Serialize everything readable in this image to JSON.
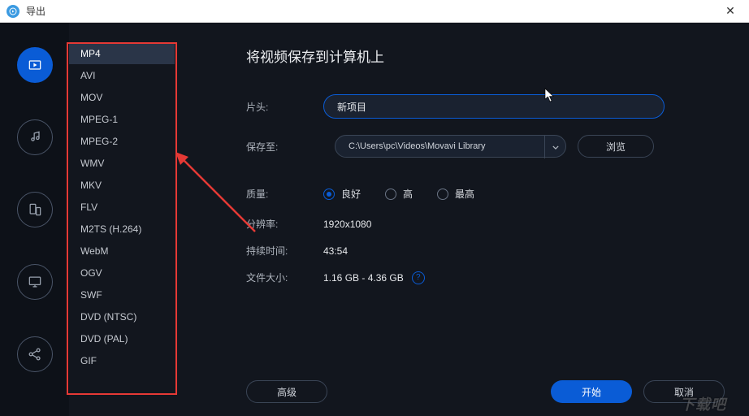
{
  "title": "导出",
  "sidebar": {
    "items": [
      {
        "name": "video-icon"
      },
      {
        "name": "music-icon"
      },
      {
        "name": "devices-icon"
      },
      {
        "name": "tv-icon"
      },
      {
        "name": "share-icon"
      }
    ]
  },
  "formats": {
    "items": [
      {
        "label": "MP4",
        "selected": true
      },
      {
        "label": "AVI"
      },
      {
        "label": "MOV"
      },
      {
        "label": "MPEG-1"
      },
      {
        "label": "MPEG-2"
      },
      {
        "label": "WMV"
      },
      {
        "label": "MKV"
      },
      {
        "label": "FLV"
      },
      {
        "label": "M2TS (H.264)"
      },
      {
        "label": "WebM"
      },
      {
        "label": "OGV"
      },
      {
        "label": "SWF"
      },
      {
        "label": "DVD (NTSC)"
      },
      {
        "label": "DVD (PAL)"
      },
      {
        "label": "GIF"
      }
    ]
  },
  "content": {
    "heading": "将视频保存到计算机上",
    "titleLabel": "片头:",
    "titleValue": "新项目",
    "saveToLabel": "保存至:",
    "saveToPath": "C:\\Users\\pc\\Videos\\Movavi Library",
    "browseLabel": "浏览",
    "qualityLabel": "质量:",
    "quality": {
      "options": [
        {
          "label": "良好",
          "checked": true
        },
        {
          "label": "高"
        },
        {
          "label": "最高"
        }
      ]
    },
    "resolutionLabel": "分辨率:",
    "resolutionValue": "1920x1080",
    "durationLabel": "持续时间:",
    "durationValue": "43:54",
    "filesizeLabel": "文件大小:",
    "filesizeValue": "1.16 GB - 4.36 GB",
    "helpIcon": "?"
  },
  "footer": {
    "advancedLabel": "高级",
    "startLabel": "开始",
    "cancelLabel": "取消"
  },
  "watermark": "下载吧"
}
